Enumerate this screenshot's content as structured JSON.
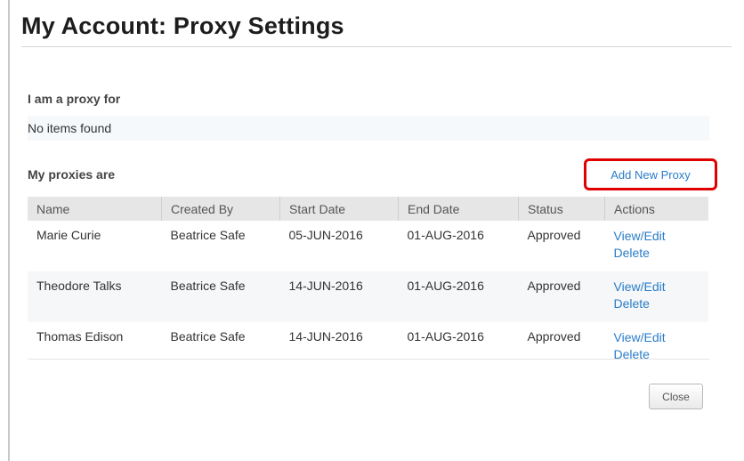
{
  "page": {
    "title": "My Account: Proxy Settings"
  },
  "proxy_for": {
    "label": "I am a proxy for",
    "empty_text": "No items found"
  },
  "my_proxies": {
    "label": "My proxies are",
    "add_link": "Add New Proxy",
    "headers": [
      "Name",
      "Created By",
      "Start Date",
      "End Date",
      "Status",
      "Actions"
    ],
    "rows": [
      {
        "name": "Marie Curie",
        "created_by": "Beatrice Safe",
        "start": "05-JUN-2016",
        "end": "01-AUG-2016",
        "status": "Approved",
        "view_edit": "View/Edit",
        "delete": "Delete"
      },
      {
        "name": "Theodore Talks",
        "created_by": "Beatrice Safe",
        "start": "14-JUN-2016",
        "end": "01-AUG-2016",
        "status": "Approved",
        "view_edit": "View/Edit",
        "delete": "Delete"
      },
      {
        "name": "Thomas Edison",
        "created_by": "Beatrice Safe",
        "start": "14-JUN-2016",
        "end": "01-AUG-2016",
        "status": "Approved",
        "view_edit": "View/Edit",
        "delete": "Delete"
      }
    ]
  },
  "footer": {
    "close_label": "Close"
  },
  "colors": {
    "link": "#2a7cc7",
    "highlight": "#e00000",
    "header_bg": "#e6e6e6"
  }
}
